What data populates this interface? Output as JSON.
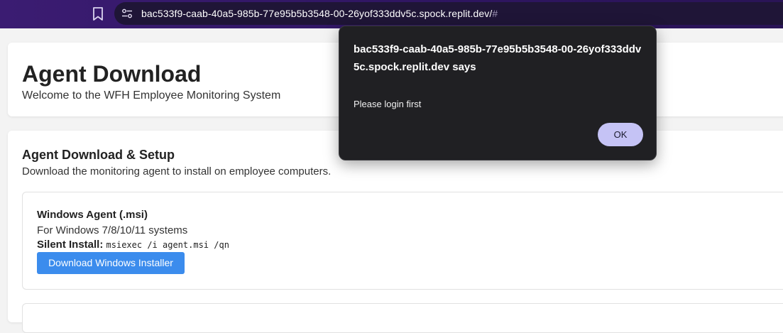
{
  "browser": {
    "url_main": "bac533f9-caab-40a5-985b-77e95b5b3548-00-26yof333ddv5c.spock.replit.dev/",
    "url_hash": "#",
    "bookmark_icon": "bookmark-icon",
    "site_info_icon": "site-settings-icon"
  },
  "header": {
    "title": "Agent Download",
    "subtitle": "Welcome to the WFH Employee Monitoring System"
  },
  "setup": {
    "title": "Agent Download & Setup",
    "description": "Download the monitoring agent to install on employee computers.",
    "windows_agent": {
      "title": "Windows Agent (.msi)",
      "description": "For Windows 7/8/10/11 systems",
      "silent_label": "Silent Install:",
      "silent_command": "msiexec /i agent.msi /qn",
      "button_label": "Download Windows Installer"
    }
  },
  "dialog": {
    "title": "bac533f9-caab-40a5-985b-77e95b5b3548-00-26yof333ddv5c.spock.replit.dev says",
    "message": "Please login first",
    "ok_label": "OK"
  },
  "colors": {
    "browser_bar": "#3b1c72",
    "accent_button": "#3b8ced",
    "dialog_bg": "#202023",
    "dialog_button": "#c5c3f5"
  }
}
